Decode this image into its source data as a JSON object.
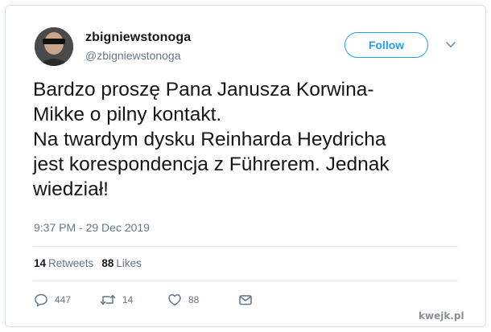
{
  "user": {
    "display_name": "zbigniewstonoga",
    "handle": "@zbigniewstonoga",
    "avatar_icon": "avatar-person-sunglasses"
  },
  "follow": {
    "label": "Follow"
  },
  "tweet": {
    "text": "Bardzo proszę Pana Janusza Korwina-\nMikke o pilny kontakt.\nNa twardym dysku Reinharda Heydricha\njest korespondencja z Führerem. Jednak\nwiedział!",
    "timestamp": "9:37 PM - 29 Dec 2019"
  },
  "stats": {
    "retweets_count": "14",
    "retweets_label": "Retweets",
    "likes_count": "88",
    "likes_label": "Likes"
  },
  "actions": {
    "replies": "447",
    "retweets": "14",
    "likes": "88"
  },
  "watermark": "kwejk.pl",
  "colors": {
    "accent": "#1da1f2",
    "text": "#14171a",
    "secondary": "#657786"
  }
}
